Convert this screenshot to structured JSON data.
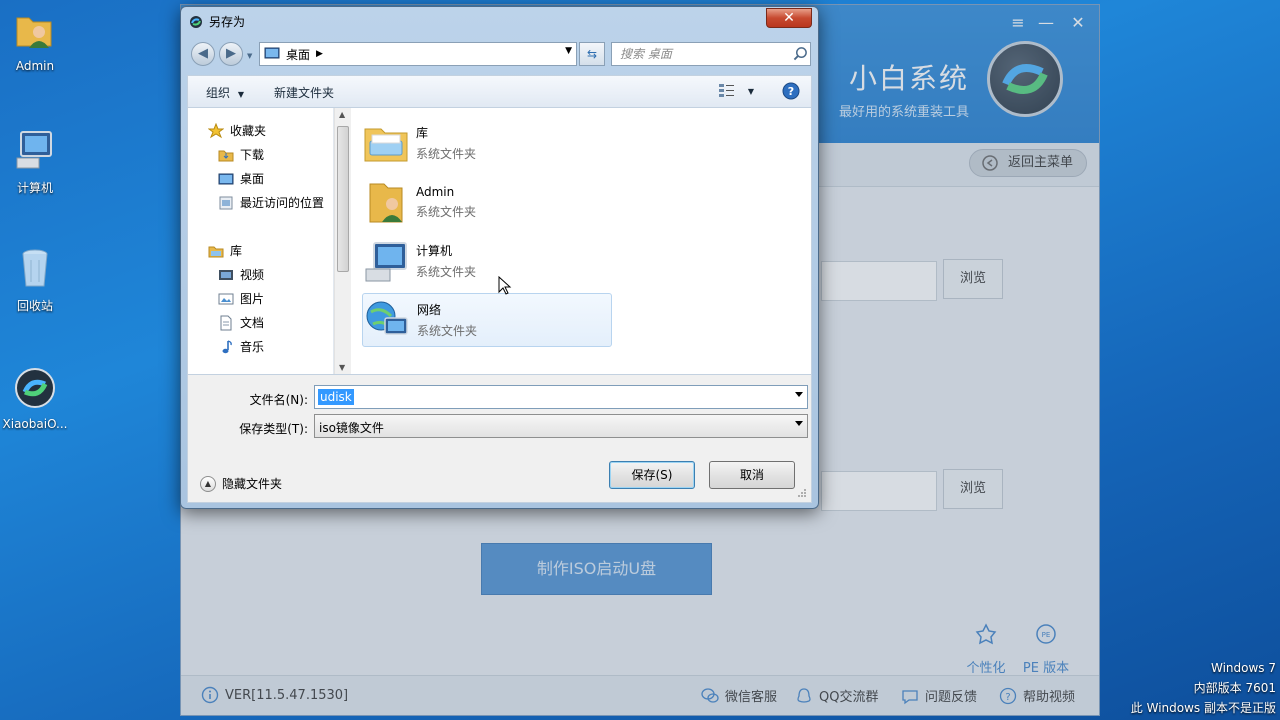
{
  "desktop": {
    "icons": [
      {
        "label": "Admin",
        "icon": "user-folder-icon"
      },
      {
        "label": "计算机",
        "icon": "computer-icon"
      },
      {
        "label": "回收站",
        "icon": "recycle-bin-icon"
      },
      {
        "label": "XiaobaiO...",
        "icon": "xiaobai-app-icon"
      }
    ],
    "watermark": [
      "Windows 7",
      "内部版本 7601",
      "此 Windows 副本不是正版"
    ]
  },
  "app": {
    "brand": "小白系统",
    "subtitle": "最好用的系统重装工具",
    "back_label": "返回主菜单",
    "browse_label": "浏览",
    "make_button": "制作ISO启动U盘",
    "features": [
      "个性化",
      "PE 版本"
    ],
    "version": "VER[11.5.47.1530]",
    "footer_links": [
      "微信客服",
      "QQ交流群",
      "问题反馈",
      "帮助视频"
    ]
  },
  "dialog": {
    "title": "另存为",
    "close": "✕",
    "address": "桌面",
    "search_placeholder": "搜索 桌面",
    "toolbar": {
      "organize": "组织",
      "new_folder": "新建文件夹"
    },
    "nav": {
      "favorites": "收藏夹",
      "favorites_items": [
        "下载",
        "桌面",
        "最近访问的位置"
      ],
      "libraries": "库",
      "library_items": [
        "视频",
        "图片",
        "文档",
        "音乐"
      ]
    },
    "files": [
      {
        "name": "库",
        "type": "系统文件夹"
      },
      {
        "name": "Admin",
        "type": "系统文件夹"
      },
      {
        "name": "计算机",
        "type": "系统文件夹"
      },
      {
        "name": "网络",
        "type": "系统文件夹"
      }
    ],
    "filename_label": "文件名(N):",
    "filename_value": "udisk",
    "filetype_label": "保存类型(T):",
    "filetype_value": "iso镜像文件",
    "hide_folders": "隐藏文件夹",
    "save_button": "保存(S)",
    "cancel_button": "取消"
  },
  "colors": {
    "accent": "#1e7cd0",
    "selection": "#3399ff"
  }
}
